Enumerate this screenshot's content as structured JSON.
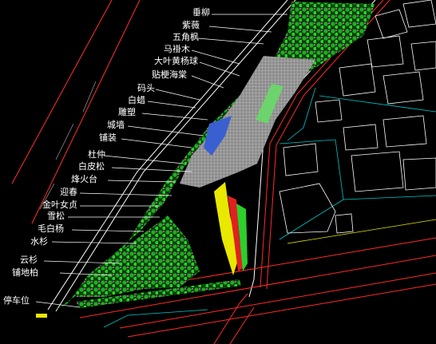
{
  "legend": {
    "labels": [
      "垂柳",
      "紫薇",
      "五角枫",
      "马褂木",
      "大叶黄杨球",
      "贴梗海棠",
      "码头",
      "白蜡",
      "雕塑",
      "城墙",
      "铺装",
      "杜仲",
      "白皮松",
      "烽火台",
      "迎春",
      "金叶女贞",
      "雪松",
      "毛白杨",
      "水杉",
      "云杉",
      "铺地柏",
      "停车位"
    ]
  },
  "colors": {
    "background": "#000000",
    "road_line": "#ff2a2a",
    "building_outline": "#ffffff",
    "parcel_line": "#00c8c8",
    "tree_green": "#1fae1f",
    "lawn": "#6dd36d",
    "paving": "#bdbdbd",
    "water": "#3a5fd0",
    "yellow_line": "#e8e800",
    "label_text": "#ffffff"
  }
}
